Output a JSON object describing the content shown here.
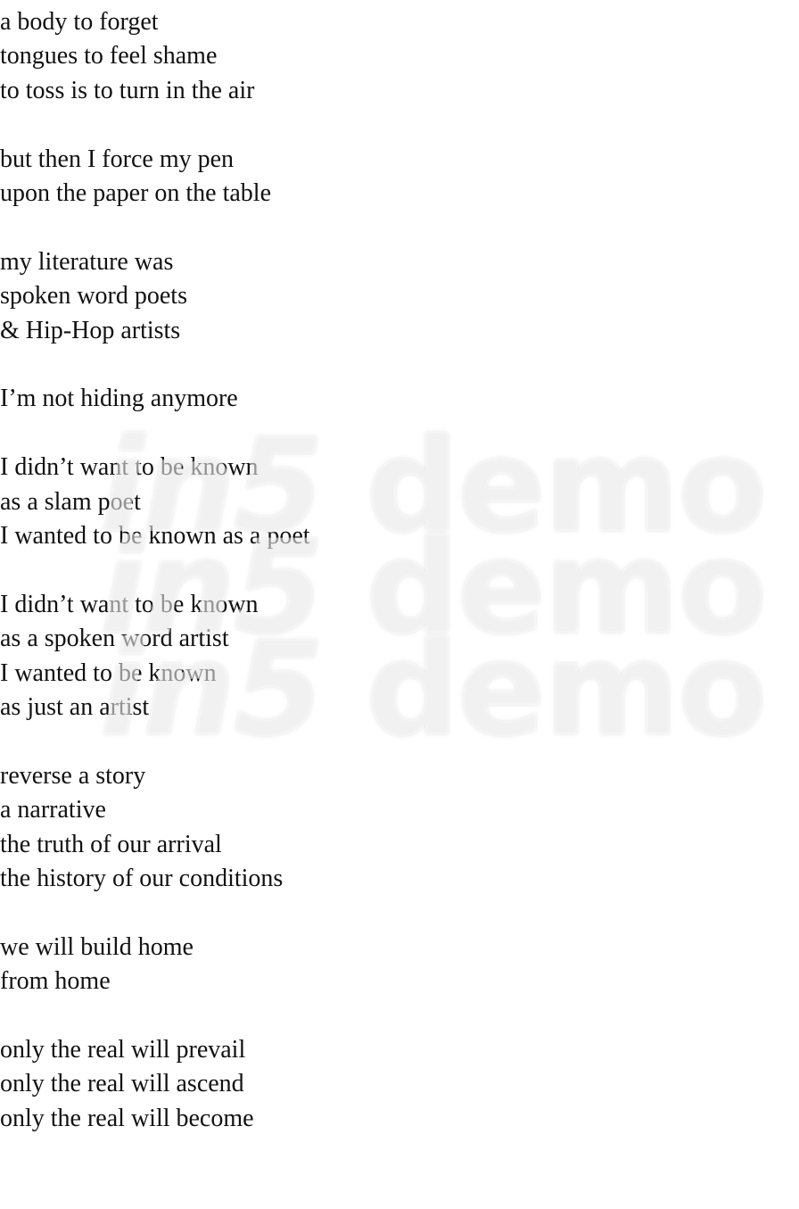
{
  "poem": {
    "stanzas": [
      {
        "lines": [
          "a body to forget",
          "tongues to feel shame",
          "to toss is to turn in the air"
        ]
      },
      {
        "lines": [
          "but then I force my pen",
          "upon the paper on the table"
        ]
      },
      {
        "lines": [
          "my literature was",
          "spoken word poets",
          "& Hip-Hop artists"
        ]
      },
      {
        "lines": [
          "I’m not hiding anymore"
        ]
      },
      {
        "lines": [
          "I didn’t want to be known",
          "as a slam poet",
          "I wanted to be known as a poet"
        ]
      },
      {
        "lines": [
          "I didn’t want to be known",
          "as a spoken word artist",
          "I wanted to be known",
          "as just an artist"
        ]
      },
      {
        "lines": [
          "reverse a story",
          "a narrative",
          "the truth of our arrival",
          "the history of our conditions"
        ]
      },
      {
        "lines": [
          "we will build home",
          "from home"
        ]
      },
      {
        "lines": [
          "only the real will prevail",
          "only the real will ascend",
          "only the real will become"
        ]
      }
    ]
  },
  "watermark": {
    "brand": "in5",
    "word": "demo",
    "repeat": [
      "in5 demo",
      "in5 demo",
      "in5 demo"
    ]
  },
  "colors": {
    "text": "#111111",
    "background": "#ffffff",
    "watermark": "#ffffff"
  }
}
